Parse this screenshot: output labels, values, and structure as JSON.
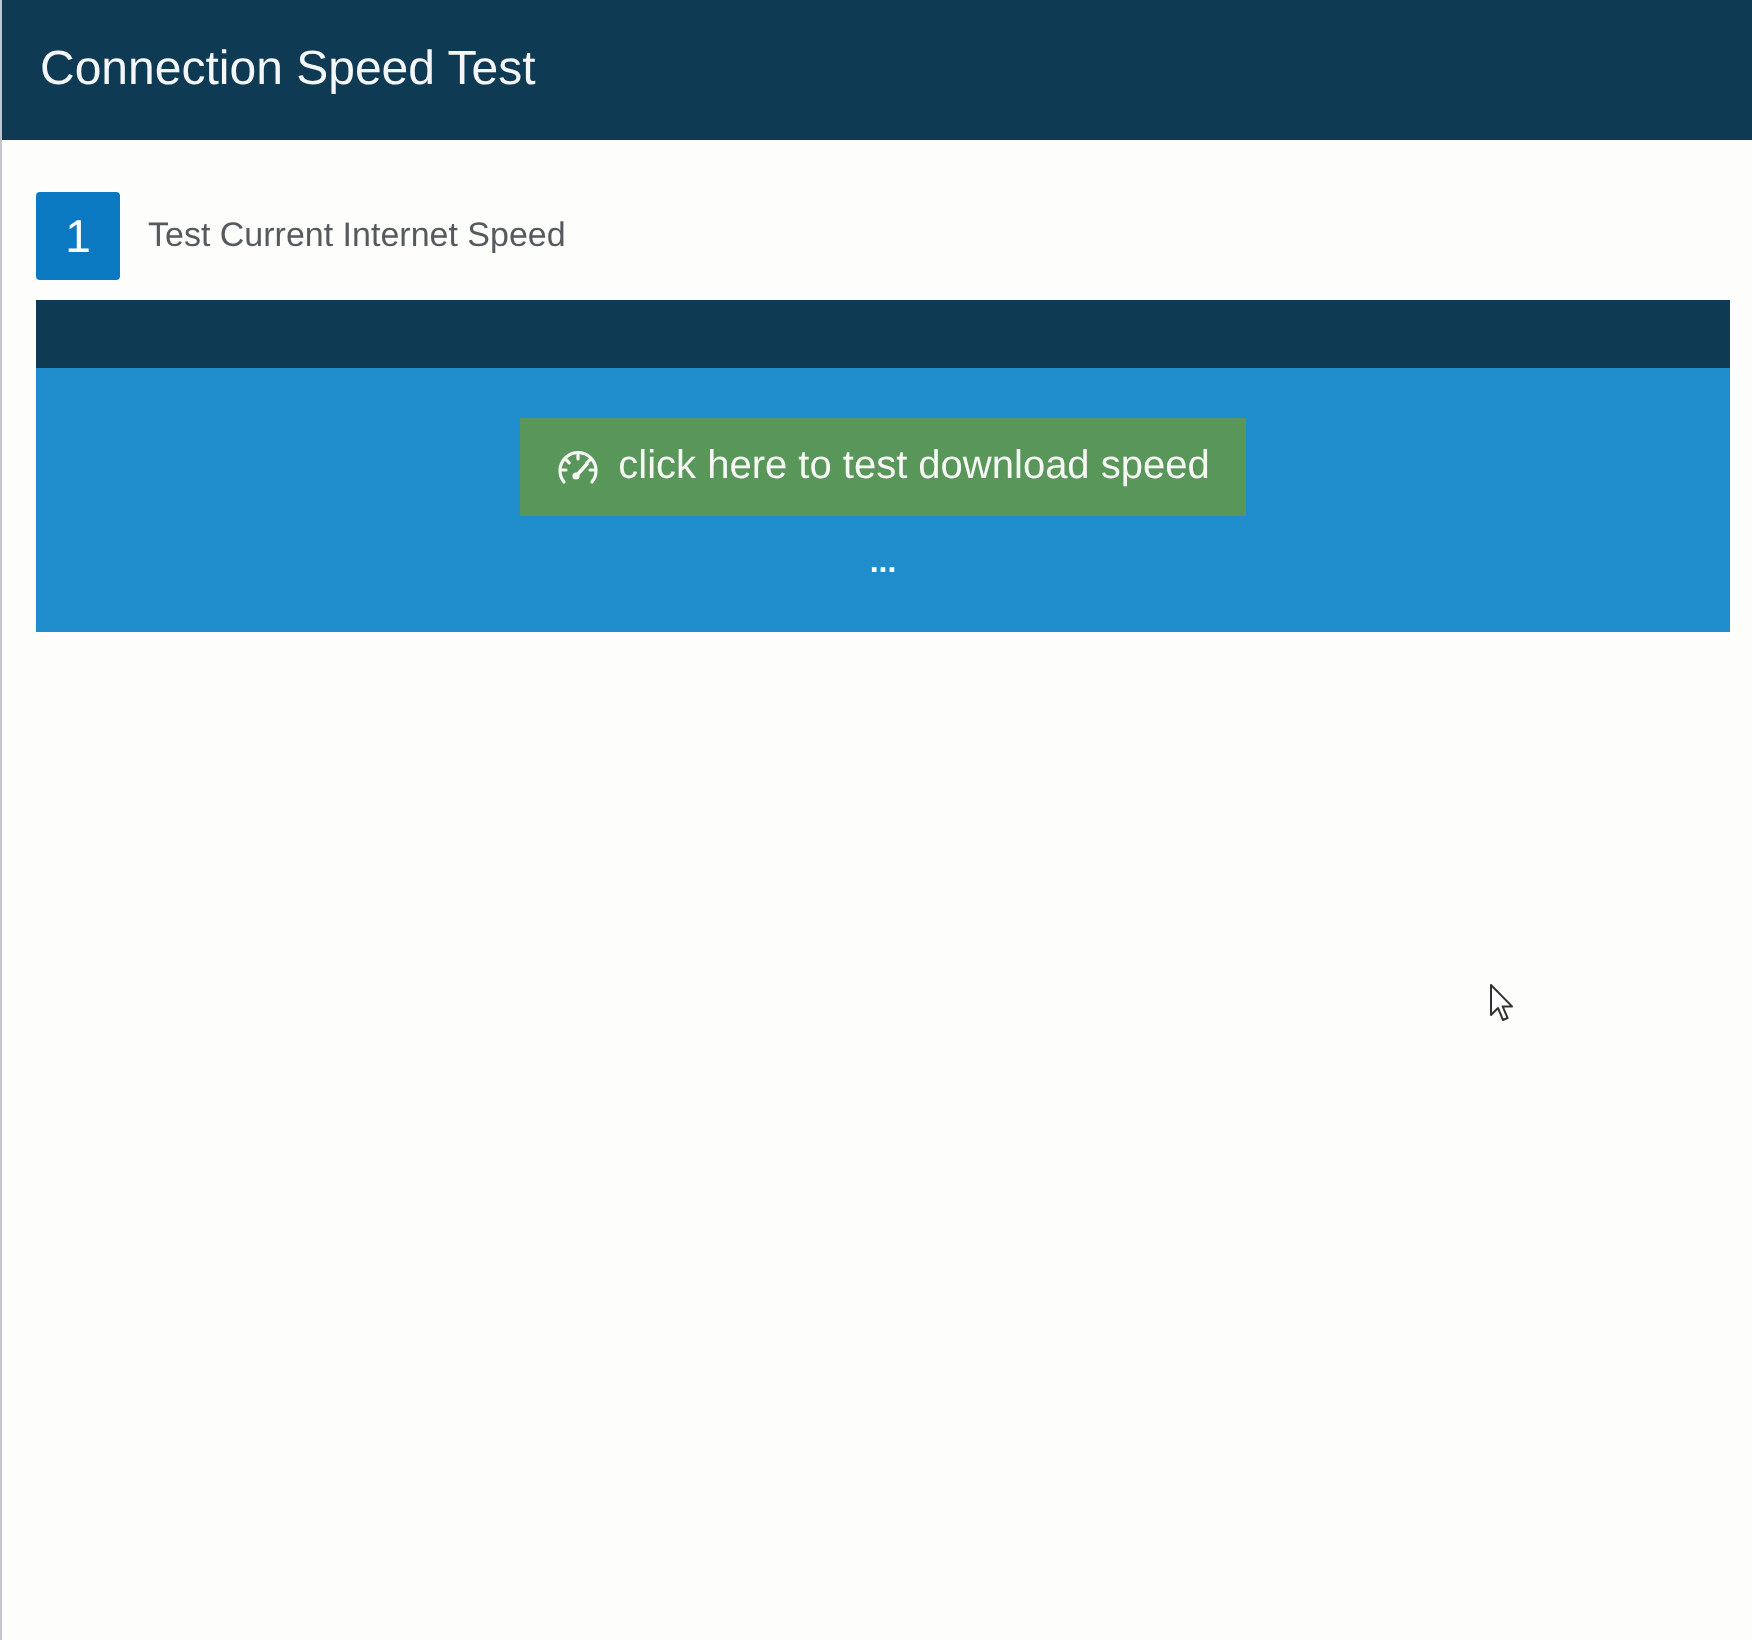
{
  "window": {
    "title": "Connection Speed Test"
  },
  "steps": [
    {
      "number": "1",
      "label": "Test Current Internet Speed"
    }
  ],
  "speed_test": {
    "button": "click here to test download speed",
    "status": "..."
  }
}
